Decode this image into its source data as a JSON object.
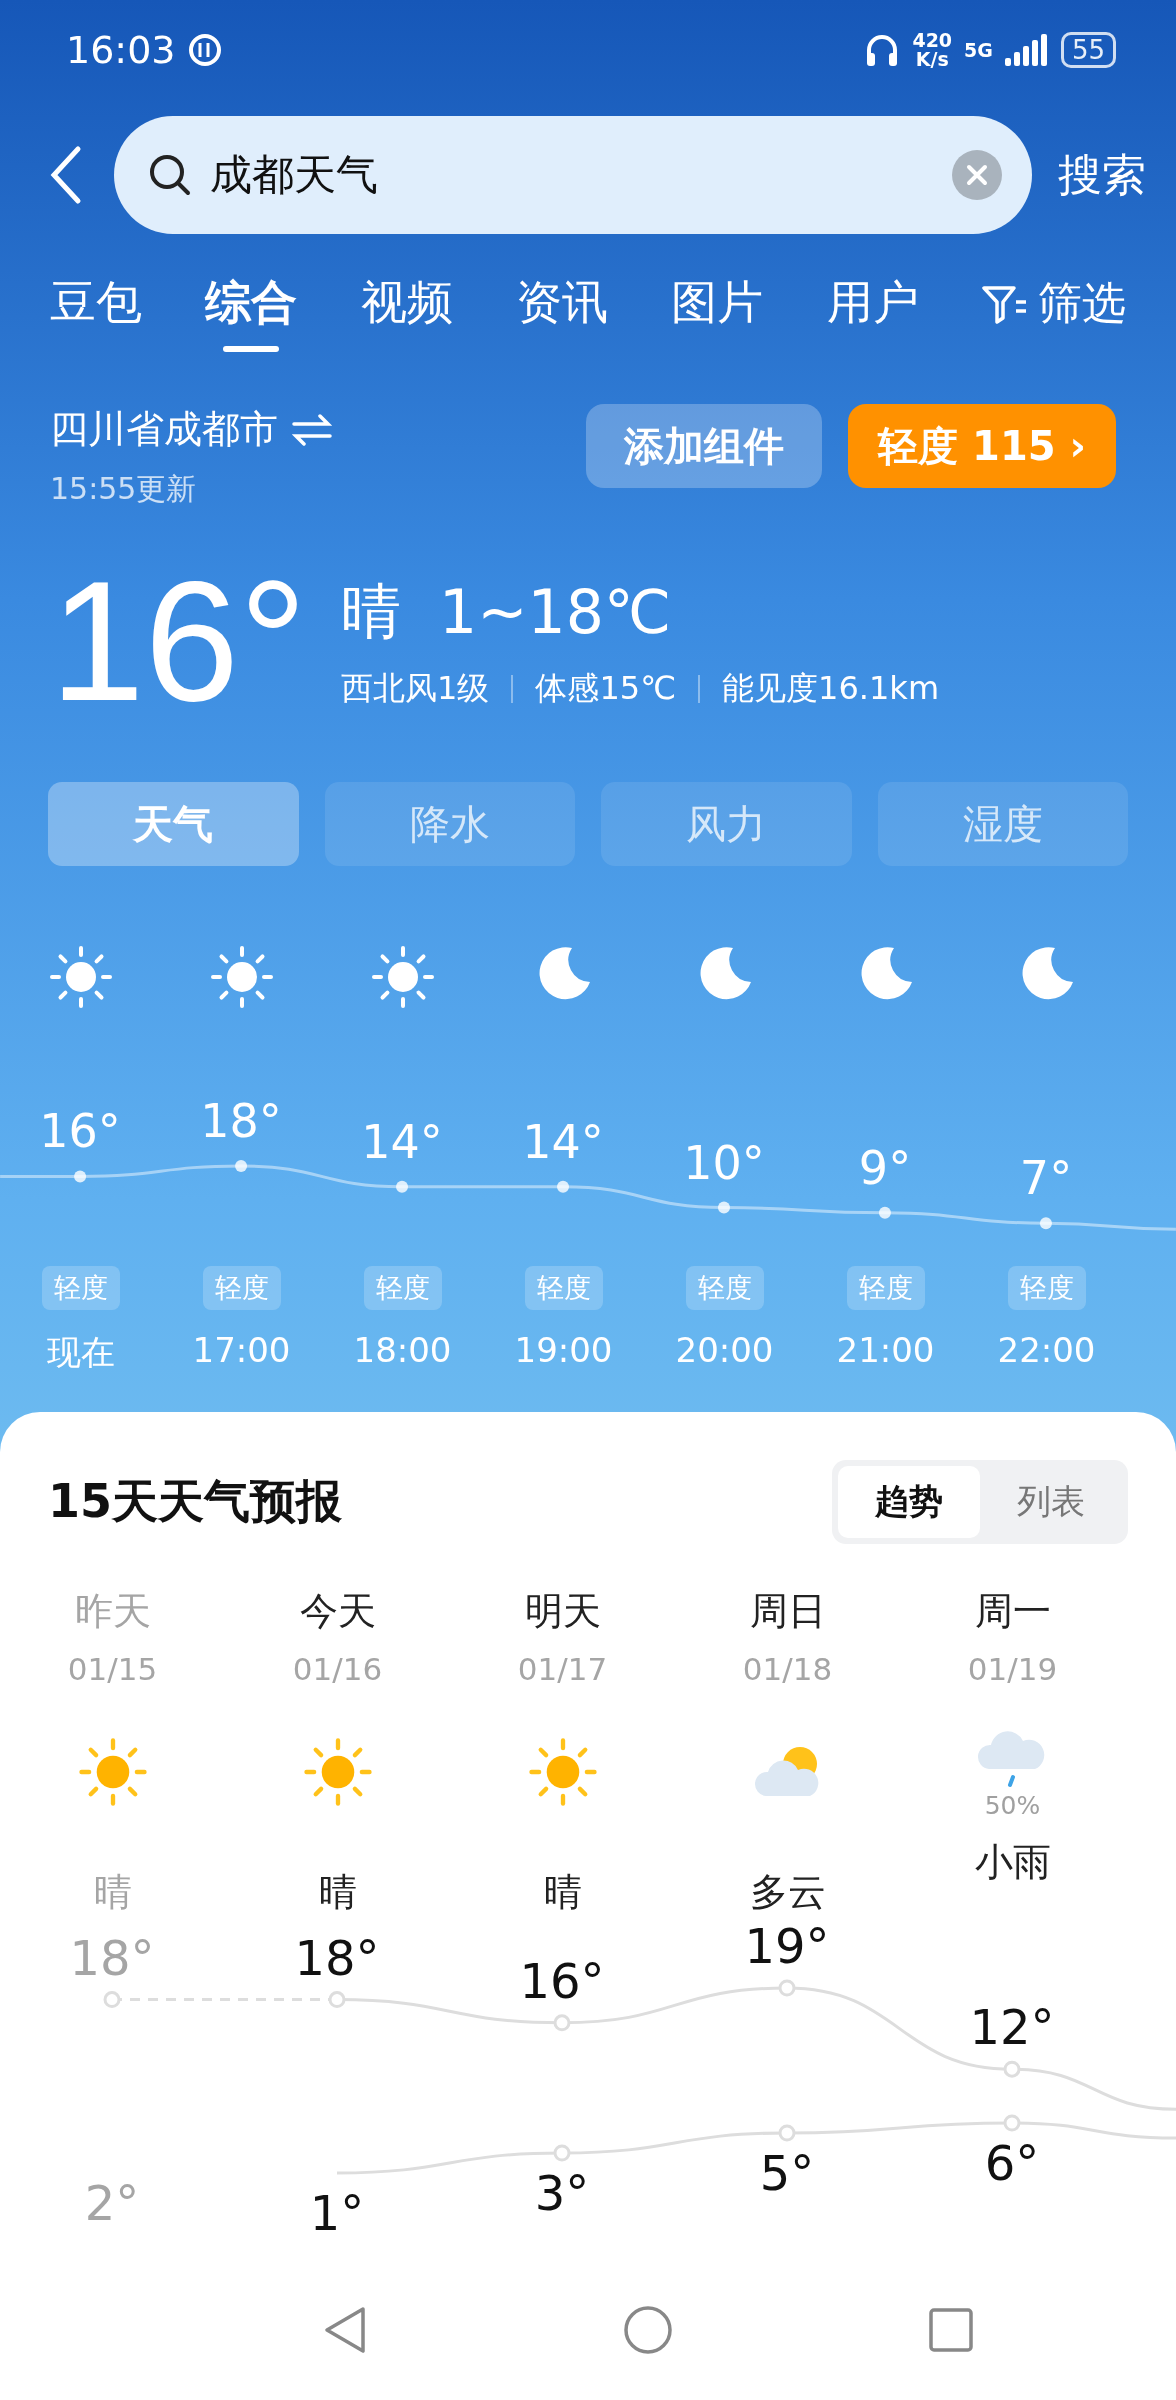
{
  "status_bar": {
    "time": "16:03",
    "speed": "420",
    "speed_unit": "K/s",
    "network": "5G",
    "battery": "55"
  },
  "search": {
    "value": "成都天气",
    "button": "搜索"
  },
  "tabs": [
    {
      "label": "豆包",
      "selected": false
    },
    {
      "label": "综合",
      "selected": true
    },
    {
      "label": "视频",
      "selected": false
    },
    {
      "label": "资讯",
      "selected": false
    },
    {
      "label": "图片",
      "selected": false
    },
    {
      "label": "用户",
      "selected": false
    }
  ],
  "filter": "筛选",
  "location": {
    "name": "四川省成都市",
    "updated": "15:55更新"
  },
  "add_widget": "添加组件",
  "aqi_button": "轻度 115",
  "aqi_arrow": "›",
  "current": {
    "temp": "16°",
    "condition": "晴",
    "range": "1~18℃",
    "details": [
      "西北风1级",
      "体感15℃",
      "能见度16.1km"
    ]
  },
  "metric_tabs": [
    {
      "label": "天气",
      "selected": true
    },
    {
      "label": "降水",
      "selected": false
    },
    {
      "label": "风力",
      "selected": false
    },
    {
      "label": "湿度",
      "selected": false
    }
  ],
  "hourly": [
    {
      "kind": "sun",
      "temp": "16°",
      "aqi": "轻度",
      "time": "现在"
    },
    {
      "kind": "sun",
      "temp": "18°",
      "aqi": "轻度",
      "time": "17:00"
    },
    {
      "kind": "sun",
      "temp": "14°",
      "aqi": "轻度",
      "time": "18:00"
    },
    {
      "kind": "moon",
      "temp": "14°",
      "aqi": "轻度",
      "time": "19:00"
    },
    {
      "kind": "moon",
      "temp": "10°",
      "aqi": "轻度",
      "time": "20:00"
    },
    {
      "kind": "moon",
      "temp": "9°",
      "aqi": "轻度",
      "time": "21:00"
    },
    {
      "kind": "moon",
      "temp": "7°",
      "aqi": "轻度",
      "time": "22:00"
    }
  ],
  "forecast": {
    "title": "15天天气预报",
    "views": [
      {
        "label": "趋势",
        "selected": true
      },
      {
        "label": "列表",
        "selected": false
      }
    ],
    "days": [
      {
        "day": "昨天",
        "date": "01/15",
        "kind": "sun",
        "condition": "晴",
        "high": "18°",
        "low": "2°",
        "past": true
      },
      {
        "day": "今天",
        "date": "01/16",
        "kind": "sun",
        "condition": "晴",
        "high": "18°",
        "low": "1°",
        "past": false
      },
      {
        "day": "明天",
        "date": "01/17",
        "kind": "sun",
        "condition": "晴",
        "high": "16°",
        "low": "3°",
        "past": false
      },
      {
        "day": "周日",
        "date": "01/18",
        "kind": "cloud-sun",
        "condition": "多云",
        "high": "19°",
        "low": "5°",
        "past": false
      },
      {
        "day": "周一",
        "date": "01/19",
        "kind": "rain",
        "rain_chance": "50%",
        "condition": "小雨",
        "high": "12°",
        "low": "6°",
        "past": false
      }
    ]
  }
}
